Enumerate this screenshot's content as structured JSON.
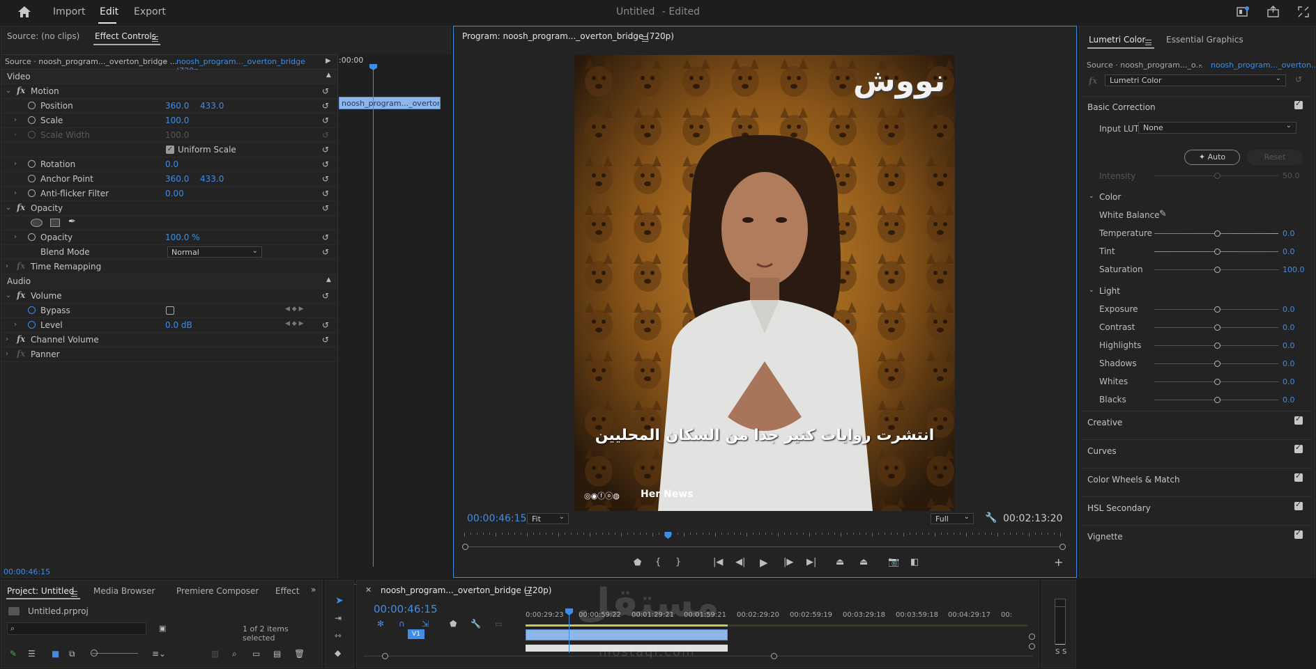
{
  "topbar": {
    "nav": [
      "Import",
      "Edit",
      "Export"
    ],
    "active": "Edit",
    "doc_title": "Untitled",
    "doc_status": "- Edited"
  },
  "source_panel": {
    "tab_source": "Source: (no clips)",
    "tab_effect_controls": "Effect Controls",
    "source_label": "Source · noosh_program..._overton_bridge ...",
    "sequence_label": "noosh_program..._overton_bridge (720p...",
    "mini_time": ":00:00",
    "clip_label": "noosh_program..._overton_bri",
    "timecode": "00:00:46:15",
    "sections": {
      "video": "Video",
      "audio": "Audio"
    },
    "rows": {
      "motion": "Motion",
      "position": "Position",
      "position_x": "360.0",
      "position_y": "433.0",
      "scale": "Scale",
      "scale_value": "100.0",
      "scale_width": "Scale Width",
      "scale_width_value": "100.0",
      "uniform_scale": "Uniform Scale",
      "rotation": "Rotation",
      "rotation_value": "0.0",
      "anchor_point": "Anchor Point",
      "anchor_x": "360.0",
      "anchor_y": "433.0",
      "anti_flicker": "Anti-flicker Filter",
      "anti_flicker_value": "0.00",
      "opacity_group": "Opacity",
      "opacity": "Opacity",
      "opacity_value": "100.0 %",
      "blend_mode": "Blend Mode",
      "blend_mode_value": "Normal",
      "time_remapping": "Time Remapping",
      "volume": "Volume",
      "bypass": "Bypass",
      "level": "Level",
      "level_value": "0.0 dB",
      "channel_volume": "Channel Volume",
      "panner": "Panner"
    }
  },
  "program_panel": {
    "title": "Program: noosh_program..._overton_bridge (720p)",
    "logo_text": "نووش",
    "subtitle": "انتشرت روايات كتير جدا من السكان المحليين",
    "watermark": "Her News",
    "timecode": "00:00:46:15",
    "fit": "Fit",
    "resolution": "Full",
    "duration": "00:02:13:20",
    "playhead_fraction": 0.34
  },
  "lumetri": {
    "tab_lumetri": "Lumetri Color",
    "tab_essential": "Essential Graphics",
    "source_label": "Source · noosh_program..._o...",
    "sequence_label": "noosh_program..._overton...",
    "effect_select": "Lumetri Color",
    "basic_correction": "Basic Correction",
    "input_lut_label": "Input LUT",
    "input_lut_value": "None",
    "auto_button": "Auto",
    "reset_button": "Reset",
    "intensity_label": "Intensity",
    "intensity_value": "50.0",
    "color_section": "Color",
    "white_balance": "White Balance",
    "sliders_color": [
      {
        "label": "Temperature",
        "value": "0.0"
      },
      {
        "label": "Tint",
        "value": "0.0"
      },
      {
        "label": "Saturation",
        "value": "100.0"
      }
    ],
    "light_section": "Light",
    "sliders_light": [
      {
        "label": "Exposure",
        "value": "0.0"
      },
      {
        "label": "Contrast",
        "value": "0.0"
      },
      {
        "label": "Highlights",
        "value": "0.0"
      },
      {
        "label": "Shadows",
        "value": "0.0"
      },
      {
        "label": "Whites",
        "value": "0.0"
      },
      {
        "label": "Blacks",
        "value": "0.0"
      }
    ],
    "sections": [
      "Creative",
      "Curves",
      "Color Wheels & Match",
      "HSL Secondary",
      "Vignette"
    ]
  },
  "project_panel": {
    "tabs": [
      "Project: Untitled",
      "Media Browser",
      "Premiere Composer",
      "Effect"
    ],
    "file": "Untitled.prproj",
    "selection": "1 of 2 items selected"
  },
  "timeline": {
    "tab": "noosh_program..._overton_bridge (720p)",
    "timecode": "00:00:46:15",
    "ruler": [
      "0:00:29:23",
      "00:00:59:22",
      "00:01:29:21",
      "00:01:59:21",
      "00:02:29:20",
      "00:02:59:19",
      "00:03:29:18",
      "00:03:59:18",
      "00:04:29:17",
      "00:"
    ],
    "track_label": "V1",
    "watermark_text": "مستقل",
    "watermark_sub": "mostaql.com"
  },
  "audio_meter": {
    "solo_left": "S",
    "solo_right": "S"
  },
  "colors": {
    "accent_blue": "#3e8ee8",
    "panel_bg": "#232323",
    "app_bg": "#1d1d1d"
  }
}
